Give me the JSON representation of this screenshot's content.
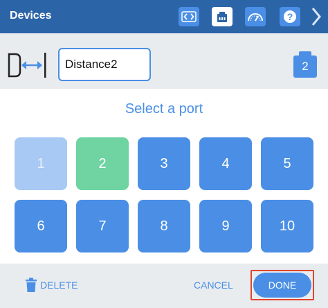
{
  "header": {
    "title": "Devices",
    "buttons": [
      {
        "icon": "code-brackets-icon"
      },
      {
        "icon": "device-icon",
        "active": true
      },
      {
        "icon": "gauge-icon"
      },
      {
        "icon": "help-icon",
        "label": "?"
      }
    ],
    "next_icon": "chevron-right-icon"
  },
  "device": {
    "icon": "distance-sensor-icon",
    "name_value": "Distance2",
    "port_badge": "2"
  },
  "main": {
    "title": "Select a port",
    "ports": [
      "1",
      "2",
      "3",
      "4",
      "5",
      "6",
      "7",
      "8",
      "9",
      "10"
    ],
    "selected_port": "2",
    "disabled_port": "1"
  },
  "footer": {
    "delete_label": "DELETE",
    "cancel_label": "CANCEL",
    "done_label": "DONE"
  },
  "colors": {
    "header_bg": "#2c64a8",
    "accent": "#4a8fe5",
    "selected": "#6fd3a2",
    "disabled": "#a7c9f4",
    "highlight": "#e0442c",
    "panel_bg": "#e9ecef"
  }
}
